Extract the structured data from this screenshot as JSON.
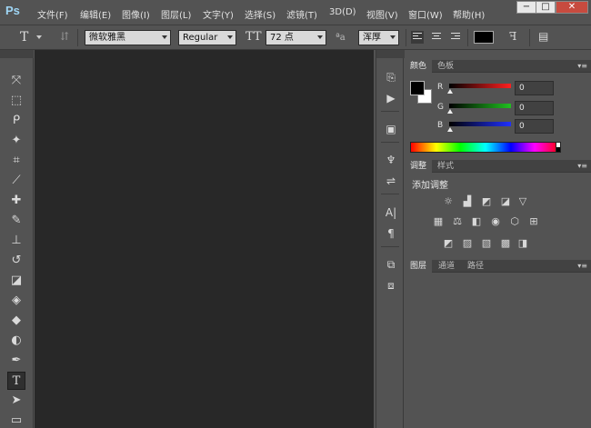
{
  "app": {
    "logo": "Ps"
  },
  "menu": [
    "文件(F)",
    "编辑(E)",
    "图像(I)",
    "图层(L)",
    "文字(Y)",
    "选择(S)",
    "滤镜(T)",
    "3D(D)",
    "视图(V)",
    "窗口(W)",
    "帮助(H)"
  ],
  "window_controls": {
    "minimize": "−",
    "maximize": "□",
    "close": "✕"
  },
  "options": {
    "font_family": "微软雅黑",
    "font_style": "Regular",
    "font_size": "72 点",
    "aa_label": "ªa",
    "antialias": "浑厚"
  },
  "panels": {
    "color": {
      "tabs": [
        "颜色",
        "色板"
      ],
      "channels": [
        {
          "label": "R",
          "value": "0",
          "color": "#ff2020"
        },
        {
          "label": "G",
          "value": "0",
          "color": "#20c020"
        },
        {
          "label": "B",
          "value": "0",
          "color": "#2030ff"
        }
      ]
    },
    "adjustments": {
      "tabs": [
        "调整",
        "样式"
      ],
      "heading": "添加调整"
    },
    "layers": {
      "tabs": [
        "图层",
        "通道",
        "路径"
      ]
    }
  }
}
